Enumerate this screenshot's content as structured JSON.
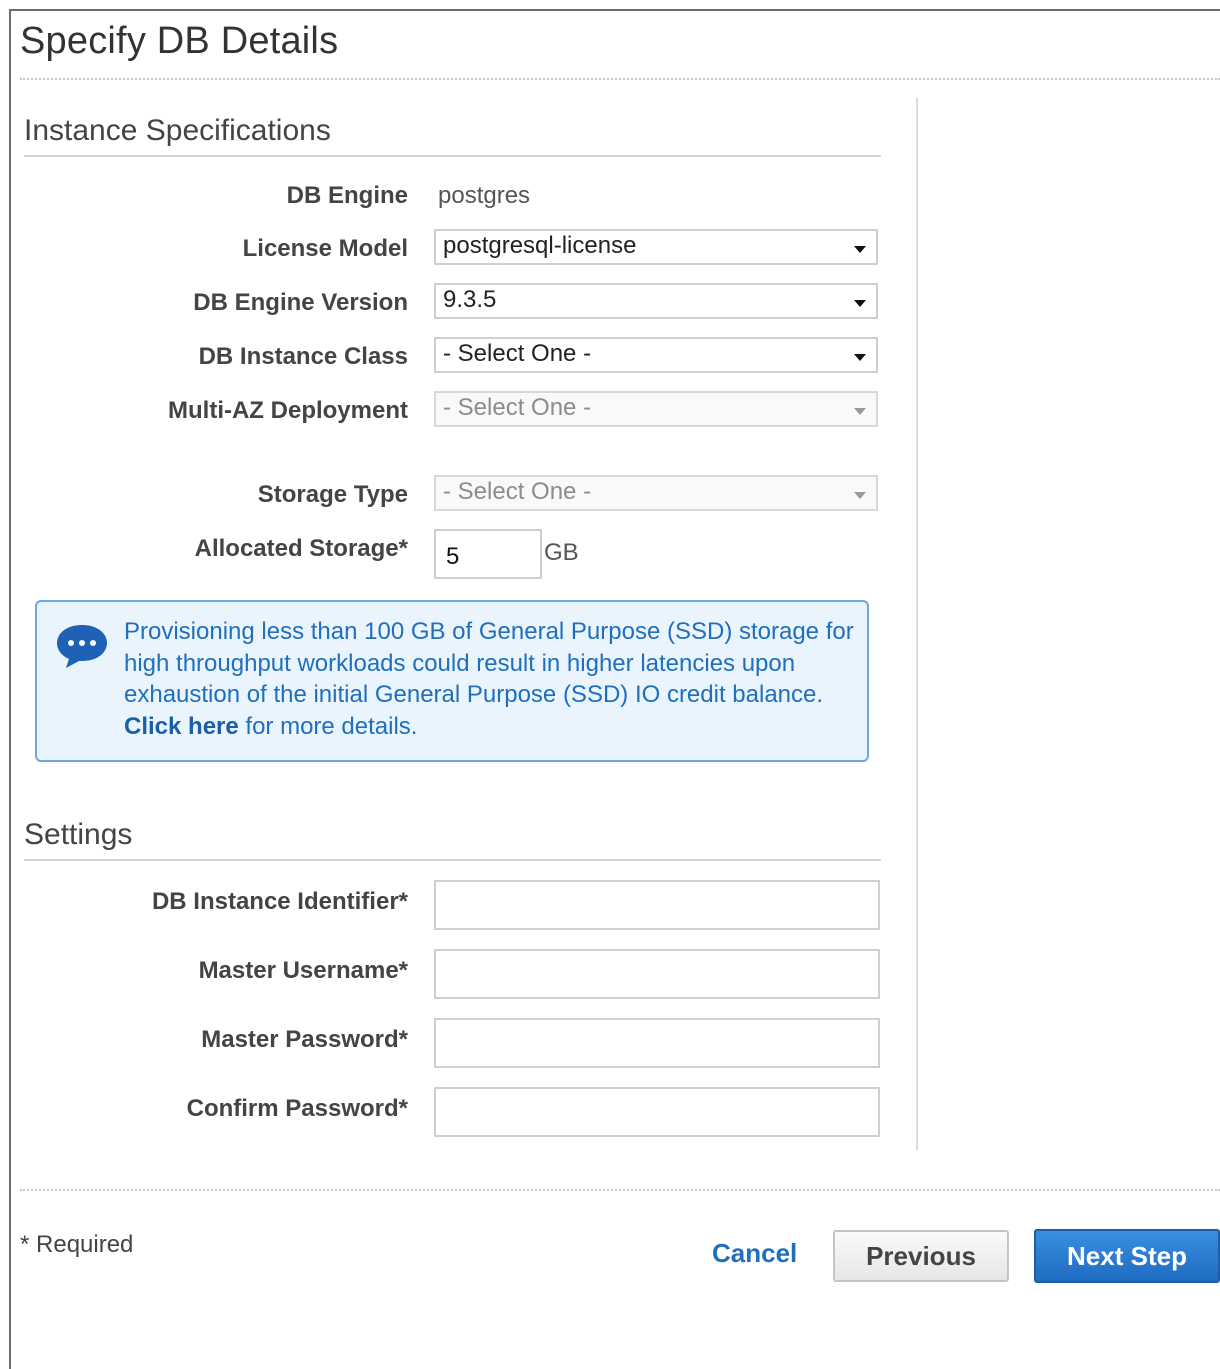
{
  "page": {
    "title": "Specify DB Details"
  },
  "instance_specifications": {
    "section_title": "Instance Specifications",
    "db_engine": {
      "label": "DB Engine",
      "value": "postgres"
    },
    "license_model": {
      "label": "License Model",
      "value": "postgresql-license"
    },
    "db_engine_version": {
      "label": "DB Engine Version",
      "value": "9.3.5"
    },
    "db_instance_class": {
      "label": "DB Instance Class",
      "value": "- Select One -"
    },
    "multi_az_deployment": {
      "label": "Multi-AZ Deployment",
      "value": "- Select One -"
    },
    "storage_type": {
      "label": "Storage Type",
      "value": "- Select One -"
    },
    "allocated_storage": {
      "label": "Allocated Storage*",
      "value": "5",
      "unit": "GB"
    }
  },
  "info_notice": {
    "icon": "speech-bubble-icon",
    "text": "Provisioning less than 100 GB of General Purpose (SSD) storage for high throughput workloads could result in higher latencies upon exhaustion of the initial General Purpose (SSD) IO credit balance.",
    "link_text": "Click here",
    "link_suffix": "for more details."
  },
  "settings": {
    "section_title": "Settings",
    "db_instance_identifier": {
      "label": "DB Instance Identifier*",
      "value": ""
    },
    "master_username": {
      "label": "Master Username*",
      "value": ""
    },
    "master_password": {
      "label": "Master Password*",
      "value": ""
    },
    "confirm_password": {
      "label": "Confirm Password*",
      "value": ""
    }
  },
  "footer": {
    "required_note": "* Required",
    "cancel_label": "Cancel",
    "previous_label": "Previous",
    "next_label": "Next Step"
  },
  "colors": {
    "link": "#1f6fbd",
    "primary_button": "#1f6cc3",
    "info_background": "#eaf4fd",
    "info_border": "#6da8e0"
  }
}
